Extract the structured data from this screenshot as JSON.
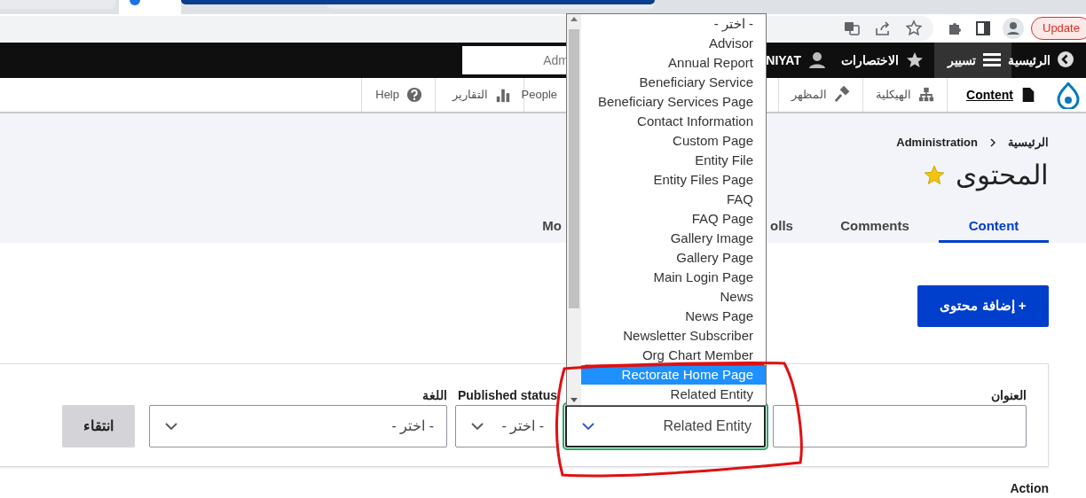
{
  "browser": {
    "update_button": "Update"
  },
  "toolbar": {
    "items": [
      {
        "label": "الرئيسية",
        "selected": false
      },
      {
        "label": "تسيير",
        "selected": true
      },
      {
        "label": "الاختصارات",
        "selected": false
      },
      {
        "label": "NIYAT",
        "selected": false
      }
    ],
    "search": {
      "placeholder": "Adm"
    }
  },
  "admin_menu": {
    "items": [
      {
        "label": "Content",
        "selected": true
      },
      {
        "label": "الهيكلية",
        "selected": false
      },
      {
        "label": "المظهر",
        "selected": false
      },
      {
        "label": "People",
        "selected": false
      },
      {
        "label": "التقارير",
        "selected": false
      },
      {
        "label": "Help",
        "selected": false
      }
    ]
  },
  "breadcrumb": [
    "الرئيسية",
    "Administration"
  ],
  "title": "المحتوى",
  "tabs": [
    {
      "label": "Content",
      "selected": true
    },
    {
      "label": "Comments",
      "selected": false
    },
    {
      "label": "olls",
      "selected": false
    },
    {
      "label": "Mo",
      "selected": false
    }
  ],
  "add_button": "+ إضافة محتوى",
  "filters": [
    {
      "kind": "text",
      "label": "العنوان",
      "focused": false
    },
    {
      "kind": "select",
      "value": "Related Entity",
      "focused": true
    },
    {
      "kind": "select",
      "label": "Published status",
      "value": "- اختر -",
      "focused": false
    },
    {
      "kind": "select",
      "label": "اللغة",
      "value": "- اختر -",
      "focused": false
    }
  ],
  "filter_button": "انتقاء",
  "next_label": "Action",
  "dropdown": {
    "options": [
      {
        "label": "- اختر -",
        "selected": false
      },
      {
        "label": "Advisor",
        "selected": false
      },
      {
        "label": "Annual Report",
        "selected": false
      },
      {
        "label": "Beneficiary Service",
        "selected": false
      },
      {
        "label": "Beneficiary Services Page",
        "selected": false
      },
      {
        "label": "Contact Information",
        "selected": false
      },
      {
        "label": "Custom Page",
        "selected": false
      },
      {
        "label": "Entity File",
        "selected": false
      },
      {
        "label": "Entity Files Page",
        "selected": false
      },
      {
        "label": "FAQ",
        "selected": false
      },
      {
        "label": "FAQ Page",
        "selected": false
      },
      {
        "label": "Gallery Image",
        "selected": false
      },
      {
        "label": "Gallery Page",
        "selected": false
      },
      {
        "label": "Main Login Page",
        "selected": false
      },
      {
        "label": "News",
        "selected": false
      },
      {
        "label": "News Page",
        "selected": false
      },
      {
        "label": "Newsletter Subscriber",
        "selected": false
      },
      {
        "label": "Org Chart Member",
        "selected": false
      },
      {
        "label": "Rectorate Home Page",
        "selected": true
      },
      {
        "label": "Related Entity",
        "selected": false
      }
    ]
  }
}
